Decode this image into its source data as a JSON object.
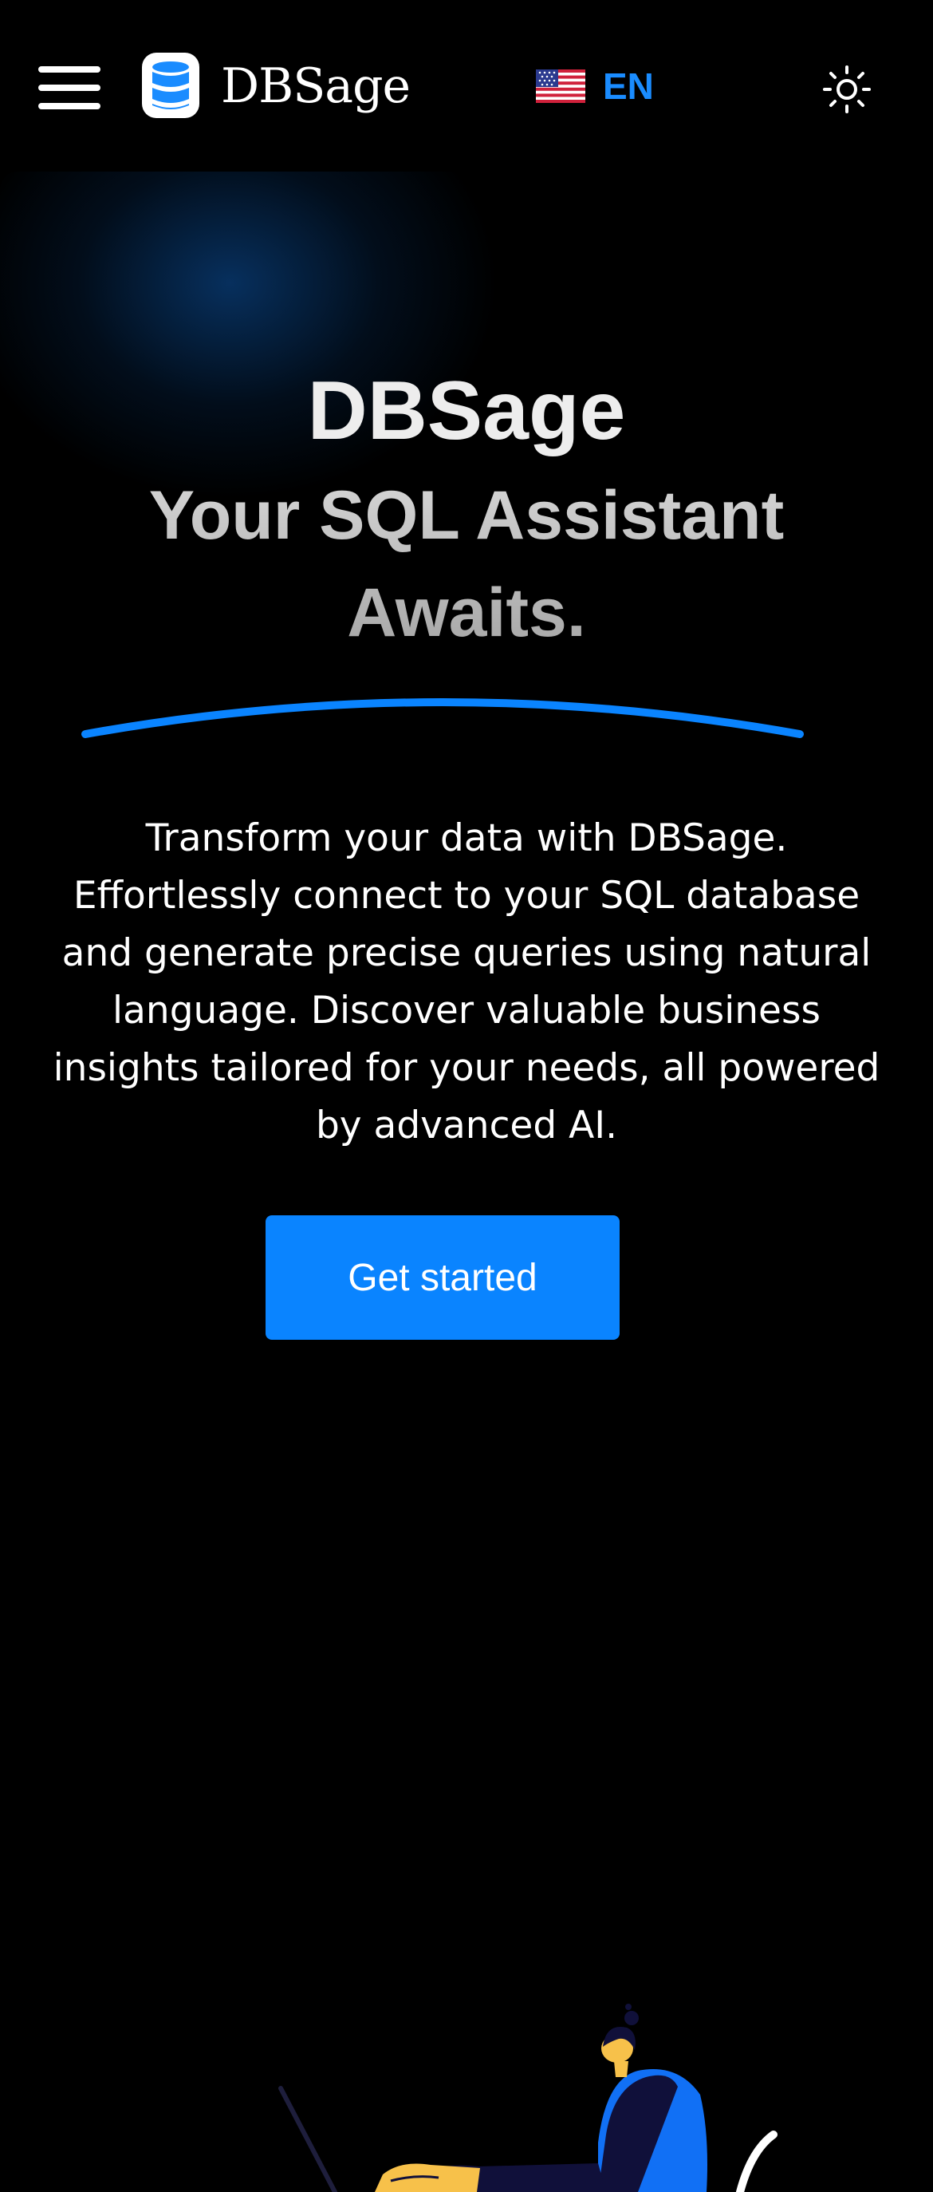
{
  "header": {
    "logo_text": "DBSage",
    "language": {
      "code": "EN",
      "flag_icon": "us-flag-icon"
    },
    "menu_icon": "hamburger-icon",
    "theme_icon": "sun-icon"
  },
  "hero": {
    "title": "DBSage",
    "subtitle": "Your SQL Assistant Awaits.",
    "description": "Transform your data with DBSage. Effortlessly connect to your SQL database and generate precise queries using natural language. Discover valuable business insights tailored for your needs, all powered by advanced AI.",
    "cta_label": "Get started"
  },
  "colors": {
    "background": "#000000",
    "accent": "#0a84ff",
    "language_text": "#1a8cff",
    "text": "#ffffff"
  }
}
